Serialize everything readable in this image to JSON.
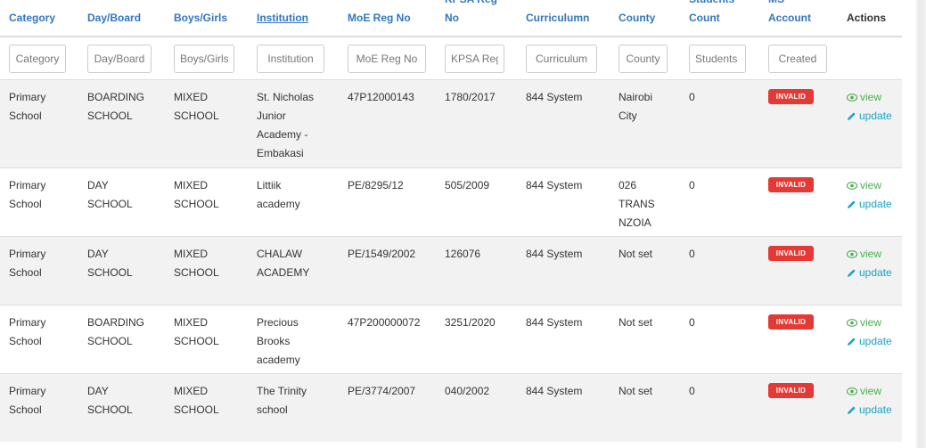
{
  "headers": [
    {
      "key": "category",
      "lines": [
        "Category"
      ]
    },
    {
      "key": "day_board",
      "lines": [
        "Day/Board"
      ]
    },
    {
      "key": "boys_girls",
      "lines": [
        "Boys/Girls"
      ]
    },
    {
      "key": "institution",
      "lines": [
        "Institution"
      ]
    },
    {
      "key": "moe_reg_no",
      "lines": [
        "MoE Reg No"
      ]
    },
    {
      "key": "kpsa_reg_no",
      "lines": [
        "KPSA Reg",
        "No"
      ]
    },
    {
      "key": "curriculum",
      "lines": [
        "Curriculumn"
      ]
    },
    {
      "key": "county",
      "lines": [
        "County"
      ]
    },
    {
      "key": "students_count",
      "lines": [
        "Students",
        "Count"
      ]
    },
    {
      "key": "ms_account",
      "lines": [
        "MS",
        "Account"
      ]
    },
    {
      "key": "actions",
      "lines": [
        "Actions"
      ]
    }
  ],
  "filters": [
    {
      "key": "category",
      "placeholder": "Category"
    },
    {
      "key": "day_board",
      "placeholder": "Day/Board"
    },
    {
      "key": "boys_girls",
      "placeholder": "Boys/Girls"
    },
    {
      "key": "institution",
      "placeholder": "Institution"
    },
    {
      "key": "moe_reg_no",
      "placeholder": "MoE Reg No"
    },
    {
      "key": "kpsa_reg_no",
      "placeholder": "KPSA Reg No"
    },
    {
      "key": "curriculum",
      "placeholder": "Curriculum"
    },
    {
      "key": "county",
      "placeholder": "County"
    },
    {
      "key": "students_count",
      "placeholder": "Students Count"
    },
    {
      "key": "ms_account",
      "placeholder": "Created"
    }
  ],
  "rows": [
    {
      "category": [
        "Primary",
        "School"
      ],
      "day_board": [
        "BOARDING",
        "SCHOOL"
      ],
      "boys_girls": [
        "MIXED",
        "SCHOOL"
      ],
      "institution": [
        "St. Nicholas",
        "Junior",
        "Academy -",
        "Embakasi"
      ],
      "moe_reg_no": [
        "47P12000143"
      ],
      "kpsa_reg_no": [
        "1780/2017"
      ],
      "curriculum": [
        "844 System"
      ],
      "county": [
        "Nairobi",
        "City"
      ],
      "students_count": [
        "0"
      ],
      "ms_account": "INVALID"
    },
    {
      "category": [
        "Primary",
        "School"
      ],
      "day_board": [
        "DAY",
        "SCHOOL"
      ],
      "boys_girls": [
        "MIXED",
        "SCHOOL"
      ],
      "institution": [
        "Littiik",
        "academy"
      ],
      "moe_reg_no": [
        "PE/8295/12"
      ],
      "kpsa_reg_no": [
        "505/2009"
      ],
      "curriculum": [
        "844 System"
      ],
      "county": [
        "026",
        "TRANS",
        "NZOIA"
      ],
      "students_count": [
        "0"
      ],
      "ms_account": "INVALID"
    },
    {
      "category": [
        "Primary",
        "School"
      ],
      "day_board": [
        "DAY",
        "SCHOOL"
      ],
      "boys_girls": [
        "MIXED",
        "SCHOOL"
      ],
      "institution": [
        "CHALAW",
        "ACADEMY"
      ],
      "moe_reg_no": [
        "PE/1549/2002"
      ],
      "kpsa_reg_no": [
        "126076"
      ],
      "curriculum": [
        "844 System"
      ],
      "county": [
        "Not set"
      ],
      "students_count": [
        "0"
      ],
      "ms_account": "INVALID"
    },
    {
      "category": [
        "Primary",
        "School"
      ],
      "day_board": [
        "BOARDING",
        "SCHOOL"
      ],
      "boys_girls": [
        "MIXED",
        "SCHOOL"
      ],
      "institution": [
        "Precious",
        "Brooks",
        "academy"
      ],
      "moe_reg_no": [
        "47P200000072"
      ],
      "kpsa_reg_no": [
        "3251/2020"
      ],
      "curriculum": [
        "844 System"
      ],
      "county": [
        "Not set"
      ],
      "students_count": [
        "0"
      ],
      "ms_account": "INVALID"
    },
    {
      "category": [
        "Primary",
        "School"
      ],
      "day_board": [
        "DAY",
        "SCHOOL"
      ],
      "boys_girls": [
        "MIXED",
        "SCHOOL"
      ],
      "institution": [
        "The Trinity",
        "school"
      ],
      "moe_reg_no": [
        "PE/3774/2007"
      ],
      "kpsa_reg_no": [
        "040/2002"
      ],
      "curriculum": [
        "844 System"
      ],
      "county": [
        "Not set"
      ],
      "students_count": [
        "0"
      ],
      "ms_account": "INVALID"
    }
  ],
  "actions": {
    "view": "view",
    "update": "update"
  },
  "colors": {
    "header_link": "#3176c1",
    "badge": "#e53935",
    "view": "#4caf50",
    "update": "#1aa3c6",
    "row_stripe": "#f2f2f2"
  }
}
